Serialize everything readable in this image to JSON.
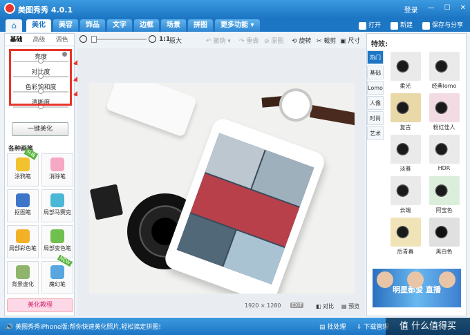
{
  "app": {
    "title": "美图秀秀 4.0.1",
    "window_buttons": [
      "登录",
      "—",
      "☐",
      "✕"
    ]
  },
  "nav": {
    "tabs": [
      "美化",
      "美容",
      "饰品",
      "文字",
      "边框",
      "场景",
      "拼图",
      "更多功能 ▾"
    ],
    "active_tab": "美化",
    "actions": [
      "打开",
      "新建",
      "保存与分享"
    ]
  },
  "left": {
    "subtabs": [
      "基础",
      "高级",
      "调色"
    ],
    "sliders": [
      "亮度",
      "对比度",
      "色彩饱和度",
      "清晰度"
    ],
    "beautify_button": "一键美化",
    "brush_section_title": "各种画笔",
    "brushes": [
      {
        "label": "涂鸦笔",
        "badge": "升级",
        "color": "#f2c12e"
      },
      {
        "label": "消除笔",
        "badge": "",
        "color": "#f5a8c3"
      },
      {
        "label": "抠图笔",
        "badge": "",
        "color": "#3d76c9"
      },
      {
        "label": "局部马赛克",
        "badge": "",
        "color": "#4bb7d7"
      },
      {
        "label": "局部彩色笔",
        "badge": "",
        "color": "#f2b127"
      },
      {
        "label": "局部变色笔",
        "badge": "",
        "color": "#6fc04f"
      },
      {
        "label": "背景虚化",
        "badge": "",
        "color": "#8fb56c"
      },
      {
        "label": "魔幻笔",
        "badge": "NEW",
        "color": "#58a6e0"
      }
    ],
    "tutorial_button": "美化教程"
  },
  "toolbar": {
    "zoom_11": "1:1",
    "original_size": "原大",
    "undo": "撤销",
    "redo": "重做",
    "reset": "原图",
    "rotate": "旋转",
    "crop": "裁剪",
    "resize": "尺寸"
  },
  "canvas": {
    "image_size": "1920 × 1280",
    "exif": "EXIF",
    "contrast": "对比",
    "preview": "预览"
  },
  "right": {
    "title": "特效:",
    "categories": [
      "热门",
      "基础",
      "Lomo",
      "人像",
      "时尚",
      "艺术"
    ],
    "active_category": "热门",
    "effects": [
      "柔光",
      "经典lomo",
      "复古",
      "粉红佳人",
      "淡雅",
      "HDR",
      "云端",
      "阿宝色",
      "后青春",
      "黑白色"
    ],
    "ad_text": "明星都爱  直播"
  },
  "status": {
    "text": "美图秀秀iPhone版:帮你快速美化照片,轻松搞定拼图!",
    "batch": "批处理",
    "download": "下载管理",
    "watermark": "值 什么值得买"
  }
}
